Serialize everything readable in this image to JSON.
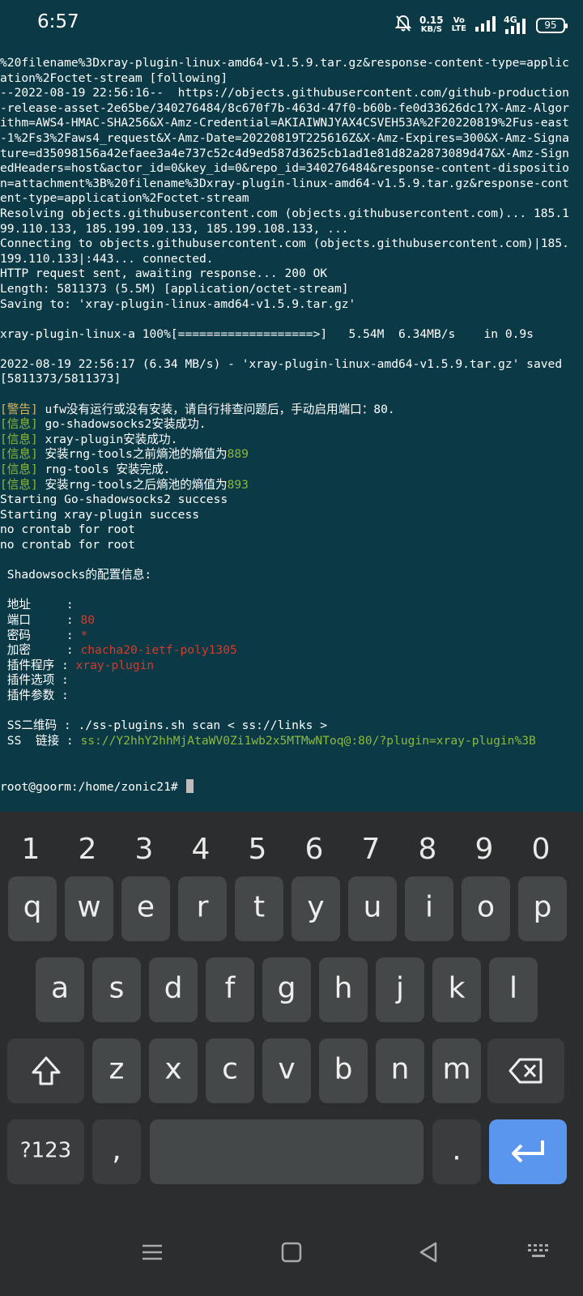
{
  "status_bar": {
    "time": "6:57",
    "net_speed_value": "0.15",
    "net_speed_unit": "KB/S",
    "volte_top": "Vo",
    "volte_bottom": "LTE",
    "network_type": "4G",
    "battery": "95",
    "icons": [
      "notifications-off-icon",
      "signal-icon",
      "4g-signal-icon",
      "battery-icon"
    ]
  },
  "terminal": {
    "lines": [
      [
        {
          "t": "%20filename%3Dxray-plugin-linux-amd64-v1.5.9.tar.gz&response-content-type=applic"
        }
      ],
      [
        {
          "t": "ation%2Foctet-stream [following]"
        }
      ],
      [
        {
          "t": "--2022-08-19 22:56:16--  https://objects.githubusercontent.com/github-production"
        }
      ],
      [
        {
          "t": "-release-asset-2e65be/340276484/8c670f7b-463d-47f0-b60b-fe0d33626dc1?X-Amz-Algor"
        }
      ],
      [
        {
          "t": "ithm=AWS4-HMAC-SHA256&X-Amz-Credential=AKIAIWNJYAX4CSVEH53A%2F20220819%2Fus-east"
        }
      ],
      [
        {
          "t": "-1%2Fs3%2Faws4_request&X-Amz-Date=20220819T225616Z&X-Amz-Expires=300&X-Amz-Signa"
        }
      ],
      [
        {
          "t": "ture=d35098156a42efaee3a4e737c52c4d9ed587d3625cb1ad1e81d82a2873089d47&X-Amz-Sign"
        }
      ],
      [
        {
          "t": "edHeaders=host&actor_id=0&key_id=0&repo_id=340276484&response-content-dispositio"
        }
      ],
      [
        {
          "t": "n=attachment%3B%20filename%3Dxray-plugin-linux-amd64-v1.5.9.tar.gz&response-cont"
        }
      ],
      [
        {
          "t": "ent-type=application%2Foctet-stream"
        }
      ],
      [
        {
          "t": "Resolving objects.githubusercontent.com (objects.githubusercontent.com)... 185.1"
        }
      ],
      [
        {
          "t": "99.110.133, 185.199.109.133, 185.199.108.133, ..."
        }
      ],
      [
        {
          "t": "Connecting to objects.githubusercontent.com (objects.githubusercontent.com)|185."
        }
      ],
      [
        {
          "t": "199.110.133|:443... connected."
        }
      ],
      [
        {
          "t": "HTTP request sent, awaiting response... 200 OK"
        }
      ],
      [
        {
          "t": "Length: 5811373 (5.5M) [application/octet-stream]"
        }
      ],
      [
        {
          "t": "Saving to: 'xray-plugin-linux-amd64-v1.5.9.tar.gz'"
        }
      ],
      [
        {
          "t": ""
        }
      ],
      [
        {
          "t": "xray-plugin-linux-a 100%[===================>]   5.54M  6.34MB/s    in 0.9s"
        }
      ],
      [
        {
          "t": ""
        }
      ],
      [
        {
          "t": "2022-08-19 22:56:17 (6.34 MB/s) - 'xray-plugin-linux-amd64-v1.5.9.tar.gz' saved"
        }
      ],
      [
        {
          "t": "[5811373/5811373]"
        }
      ],
      [
        {
          "t": ""
        }
      ],
      [
        {
          "t": "[警告]",
          "c": "yellow"
        },
        {
          "t": " ufw没有运行或没有安装，请自行排查问题后，手动启用端口：80."
        }
      ],
      [
        {
          "t": "[信息]",
          "c": "green"
        },
        {
          "t": " go-shadowsocks2安装成功."
        }
      ],
      [
        {
          "t": "[信息]",
          "c": "green"
        },
        {
          "t": " xray-plugin安装成功."
        }
      ],
      [
        {
          "t": "[信息]",
          "c": "green"
        },
        {
          "t": " 安装rng-tools之前熵池的熵值为"
        },
        {
          "t": "889",
          "c": "green"
        }
      ],
      [
        {
          "t": "[信息]",
          "c": "green"
        },
        {
          "t": " rng-tools 安装完成."
        }
      ],
      [
        {
          "t": "[信息]",
          "c": "green"
        },
        {
          "t": " 安装rng-tools之后熵池的熵值为"
        },
        {
          "t": "893",
          "c": "green"
        }
      ],
      [
        {
          "t": "Starting Go-shadowsocks2 success"
        }
      ],
      [
        {
          "t": "Starting xray-plugin success"
        }
      ],
      [
        {
          "t": "no crontab for root"
        }
      ],
      [
        {
          "t": "no crontab for root"
        }
      ],
      [
        {
          "t": ""
        }
      ],
      [
        {
          "t": " Shadowsocks的配置信息:"
        }
      ],
      [
        {
          "t": ""
        }
      ],
      [
        {
          "t": " 地址     :"
        }
      ],
      [
        {
          "t": " 端口     : "
        },
        {
          "t": "80",
          "c": "red"
        }
      ],
      [
        {
          "t": " 密码     : "
        },
        {
          "t": "*",
          "c": "red"
        }
      ],
      [
        {
          "t": " 加密     : "
        },
        {
          "t": "chacha20-ietf-poly1305",
          "c": "red"
        }
      ],
      [
        {
          "t": " 插件程序 : "
        },
        {
          "t": "xray-plugin",
          "c": "red"
        }
      ],
      [
        {
          "t": " 插件选项 :"
        }
      ],
      [
        {
          "t": " 插件参数 :"
        }
      ],
      [
        {
          "t": ""
        }
      ],
      [
        {
          "t": " SS二维码 : ./ss-plugins.sh scan < ss://links >"
        }
      ],
      [
        {
          "t": " SS  链接 : "
        },
        {
          "t": "ss://Y2hhY2hhMjAtaWV0Zi1wb2x5MTMwNToq@:80/?plugin=xray-plugin%3B",
          "c": "green"
        }
      ],
      [
        {
          "t": ""
        }
      ],
      [
        {
          "t": ""
        }
      ]
    ],
    "prompt": "root@goorm:/home/zonic21# "
  },
  "keyboard": {
    "number_row": [
      "1",
      "2",
      "3",
      "4",
      "5",
      "6",
      "7",
      "8",
      "9",
      "0"
    ],
    "row1": [
      "q",
      "w",
      "e",
      "r",
      "t",
      "y",
      "u",
      "i",
      "o",
      "p"
    ],
    "row2": [
      "a",
      "s",
      "d",
      "f",
      "g",
      "h",
      "j",
      "k",
      "l"
    ],
    "row3": [
      "z",
      "x",
      "c",
      "v",
      "b",
      "n",
      "m"
    ],
    "symbols_label": "?123",
    "comma": ",",
    "period": ".",
    "shift_icon": "shift-icon",
    "backspace_icon": "backspace-icon",
    "enter_icon": "enter-icon",
    "colors": {
      "enter": "#5a95ee",
      "key": "#454849",
      "background": "#2b2d2e"
    }
  },
  "nav_bar": {
    "icons": [
      "recent-apps-icon",
      "home-icon",
      "back-icon",
      "keyboard-switch-icon"
    ]
  },
  "colors": {
    "terminal_bg": "#0b3a46",
    "warn": "#d9b85c",
    "info": "#8cb83c",
    "value": "#d23c2b"
  }
}
